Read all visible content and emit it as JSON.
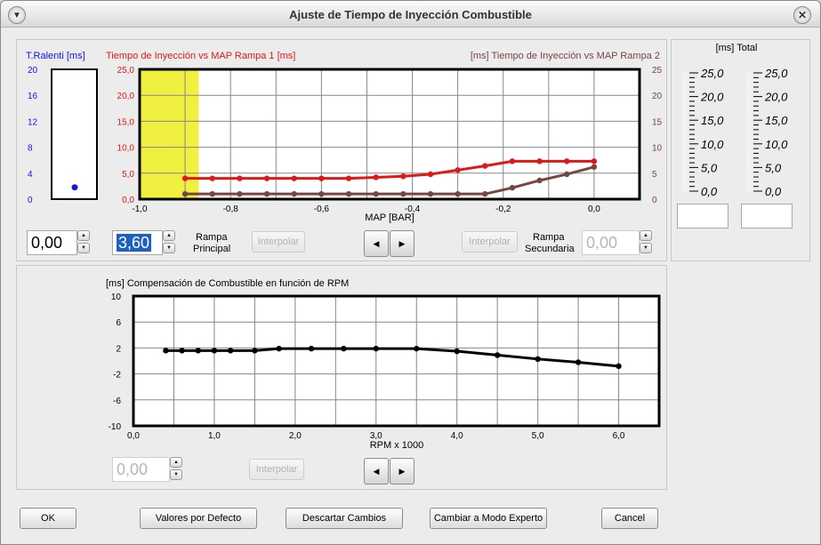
{
  "window": {
    "title": "Ajuste de Tiempo de Inyección Combustible"
  },
  "ralenti": {
    "title": "T.Ralenti [ms]",
    "ticks": [
      "20",
      "16",
      "12",
      "8",
      "4",
      "0"
    ],
    "value": 1.0,
    "color": "#1414e0"
  },
  "map_chart": {
    "title_left": "Tiempo de Inyección vs MAP Rampa 1 [ms]",
    "title_right": "[ms] Tiempo de Inyección vs MAP Rampa 2",
    "y_left_ticks": [
      "25,0",
      "20,0",
      "15,0",
      "10,0",
      "5,0",
      "0,0"
    ],
    "y_right_ticks": [
      "25",
      "20",
      "15",
      "10",
      "5",
      "0"
    ],
    "x_ticks": [
      "-1,0",
      "-0,8",
      "-0,6",
      "-0,4",
      "-0,2",
      "0,0"
    ],
    "xlabel": "MAP [BAR]",
    "highlight_color": "#f0f040",
    "color_rampa1": "#e01818",
    "color_rampa2": "#7a4444"
  },
  "controls_top": {
    "ralenti_value": "0,00",
    "rampa_principal_value": "3,60",
    "rampa_principal_label_1": "Rampa",
    "rampa_principal_label_2": "Principal",
    "interpolar_1": "Interpolar",
    "interpolar_2": "Interpolar",
    "rampa_secundaria_label_1": "Rampa",
    "rampa_secundaria_label_2": "Secundaria",
    "rampa_secundaria_value": "0,00"
  },
  "total": {
    "title": "[ms] Total",
    "ticks": [
      "25,0",
      "20,0",
      "15,0",
      "10,0",
      "5,0",
      "0,0"
    ],
    "value_1": "",
    "value_2": ""
  },
  "rpm_chart": {
    "title": "[ms] Compensación de Combustible en función de RPM",
    "y_ticks": [
      "10",
      "6",
      "2",
      "-2",
      "-6",
      "-10"
    ],
    "x_ticks": [
      "0,0",
      "1,0",
      "2,0",
      "3,0",
      "4,0",
      "5,0",
      "6,0"
    ],
    "xlabel": "RPM x 1000",
    "color": "#000000"
  },
  "controls_bottom": {
    "value": "0,00",
    "interpolar": "Interpolar"
  },
  "footer": {
    "ok": "OK",
    "defaults": "Valores por Defecto",
    "discard": "Descartar Cambios",
    "expert": "Cambiar a Modo Experto",
    "cancel": "Cancel"
  },
  "chart_data": [
    {
      "type": "line",
      "title": "Tiempo de Inyección vs MAP Rampa 1 [ms]",
      "xlabel": "MAP [BAR]",
      "ylabel": "[ms]",
      "xlim": [
        -1.0,
        0.1
      ],
      "ylim": [
        0,
        25
      ],
      "grid": true,
      "highlight_x_range": [
        -1.0,
        -0.87
      ],
      "series": [
        {
          "name": "Rampa 1",
          "x": [
            -0.9,
            -0.84,
            -0.78,
            -0.72,
            -0.66,
            -0.6,
            -0.54,
            -0.48,
            -0.42,
            -0.36,
            -0.3,
            -0.24,
            -0.18,
            -0.12,
            -0.06,
            0.0
          ],
          "values": [
            4.0,
            4.0,
            4.0,
            4.0,
            4.0,
            4.0,
            4.0,
            4.2,
            4.4,
            4.8,
            5.6,
            6.4,
            7.3,
            7.3,
            7.3,
            7.3
          ]
        },
        {
          "name": "Rampa 2",
          "x": [
            -0.9,
            -0.84,
            -0.78,
            -0.72,
            -0.66,
            -0.6,
            -0.54,
            -0.48,
            -0.42,
            -0.36,
            -0.3,
            -0.24,
            -0.18,
            -0.12,
            -0.06,
            0.0
          ],
          "values": [
            1.0,
            1.0,
            1.0,
            1.0,
            1.0,
            1.0,
            1.0,
            1.0,
            1.0,
            1.0,
            1.0,
            1.0,
            2.2,
            3.6,
            4.8,
            6.2
          ]
        }
      ]
    },
    {
      "type": "line",
      "title": "[ms] Compensación de Combustible en función de RPM",
      "xlabel": "RPM x 1000",
      "xlim": [
        0,
        6.5
      ],
      "ylim": [
        -10,
        10
      ],
      "grid": true,
      "series": [
        {
          "x": [
            0.4,
            0.6,
            0.8,
            1.0,
            1.2,
            1.5,
            1.8,
            2.2,
            2.6,
            3.0,
            3.5,
            4.0,
            4.5,
            5.0,
            5.5,
            6.0
          ],
          "values": [
            1.6,
            1.6,
            1.6,
            1.6,
            1.6,
            1.6,
            1.9,
            1.9,
            1.9,
            1.9,
            1.9,
            1.5,
            0.9,
            0.3,
            -0.2,
            -0.8
          ]
        }
      ]
    }
  ]
}
